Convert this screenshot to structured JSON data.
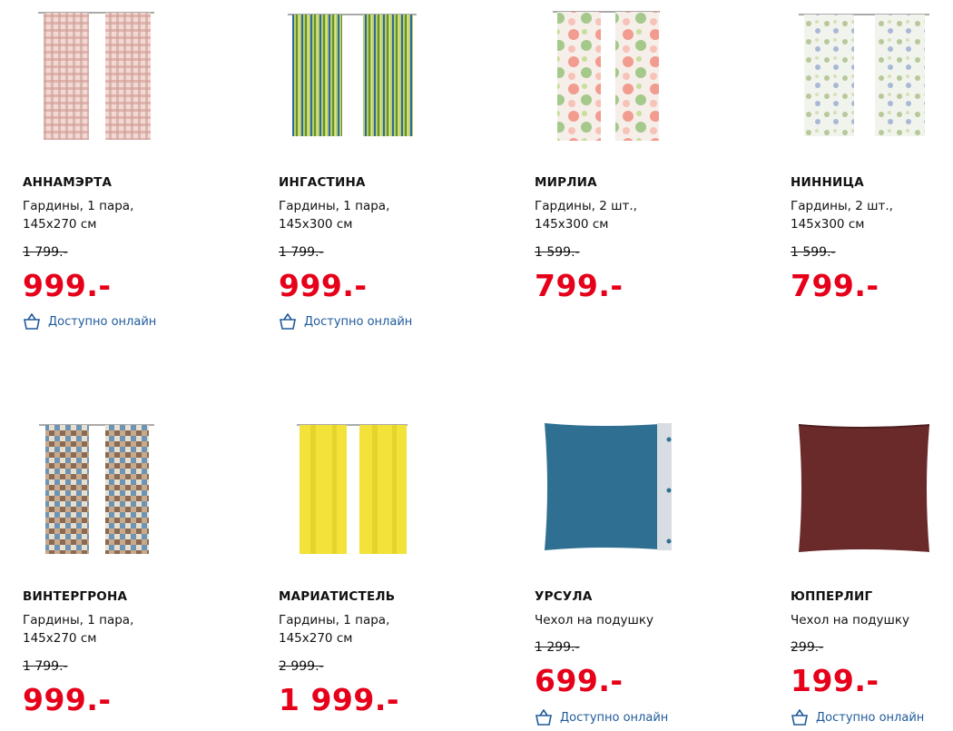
{
  "products": [
    {
      "name": "АННАМЭРТА",
      "desc_1": "Гардины, 1 пара,",
      "desc_2": "145x270 см",
      "old_price": "1 799.-",
      "price": "999.-",
      "availability": "Доступно онлайн",
      "image": "curtain-checkered-pink"
    },
    {
      "name": "ИНГАСТИНА",
      "desc_1": "Гардины, 1 пара,",
      "desc_2": "145x300 см",
      "old_price": "1 799.-",
      "price": "999.-",
      "availability": "Доступно онлайн",
      "image": "curtain-striped-green-blue"
    },
    {
      "name": "МИРЛИА",
      "desc_1": "Гардины, 2 шт.,",
      "desc_2": "145x300 см",
      "old_price": "1 599.-",
      "price": "799.-",
      "availability": "",
      "image": "curtain-floral-pink-green"
    },
    {
      "name": "НИННИЦА",
      "desc_1": "Гардины, 2 шт.,",
      "desc_2": "145x300 см",
      "old_price": "1 599.-",
      "price": "799.-",
      "availability": "",
      "image": "curtain-floral-light"
    },
    {
      "name": "ВИНТЕРГРОНА",
      "desc_1": "Гардины, 1 пара,",
      "desc_2": "145x270 см",
      "old_price": "1 799.-",
      "price": "999.-",
      "availability": "",
      "image": "curtain-pattern-blue-brown"
    },
    {
      "name": "МАРИАТИСТЕЛЬ",
      "desc_1": "Гардины, 1 пара,",
      "desc_2": "145x270 см",
      "old_price": "2 999.-",
      "price": "1 999.-",
      "availability": "",
      "image": "curtain-yellow"
    },
    {
      "name": "УРСУЛА",
      "desc_1": "Чехол на подушку",
      "desc_2": "",
      "old_price": "1 299.-",
      "price": "699.-",
      "availability": "Доступно онлайн",
      "image": "cushion-cover-blue"
    },
    {
      "name": "ЮППЕРЛИГ",
      "desc_1": "Чехол на подушку",
      "desc_2": "",
      "old_price": "299.-",
      "price": "199.-",
      "availability": "Доступно онлайн",
      "image": "cushion-cover-burgundy"
    }
  ],
  "colors": {
    "price": "#e60019",
    "link": "#1f5a9a"
  }
}
